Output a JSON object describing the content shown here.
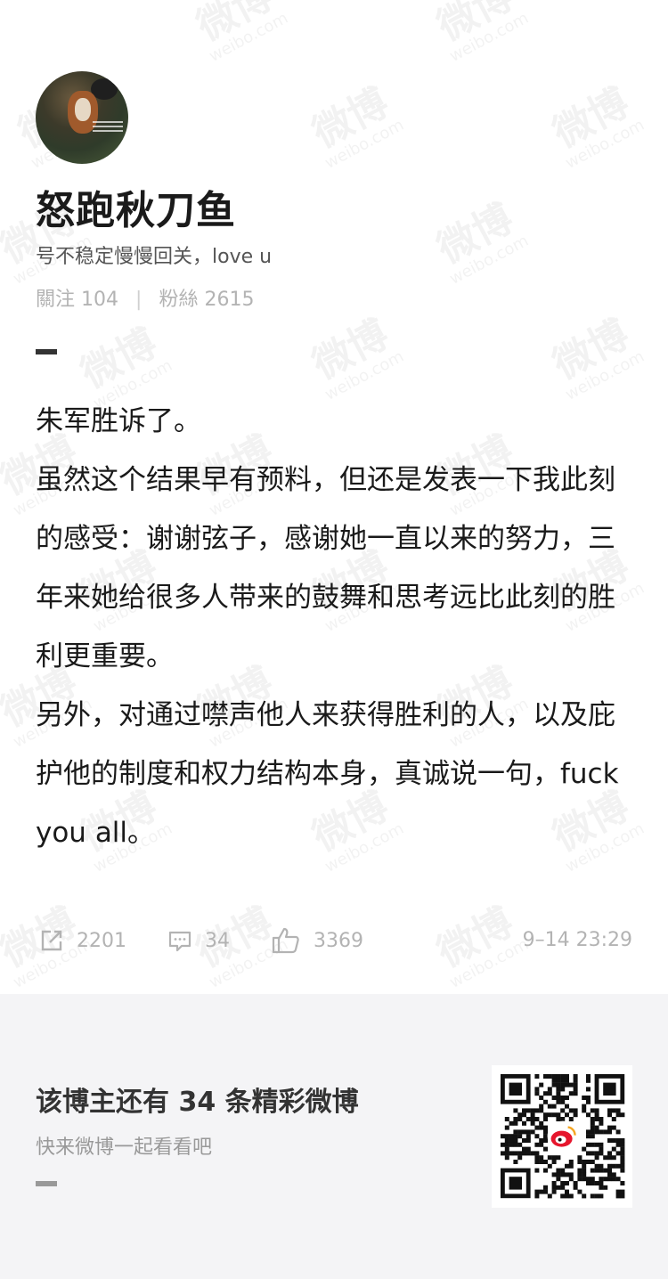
{
  "profile": {
    "username": "怒跑秋刀鱼",
    "bio": "号不稳定慢慢回关，love u",
    "following_label": "關注",
    "following_count": "104",
    "separator": "|",
    "followers_label": "粉絲",
    "followers_count": "2615"
  },
  "post": {
    "paragraphs": [
      "朱军胜诉了。",
      "虽然这个结果早有预料，但还是发表一下我此刻的感受：谢谢弦子，感谢她一直以来的努力，三年来她给很多人带来的鼓舞和思考远比此刻的胜利更重要。",
      "另外，对通过噤声他人来获得胜利的人，以及庇护他的制度和权力结构本身，真诚说一句，fuck you all。"
    ]
  },
  "actions": {
    "share_count": "2201",
    "comment_count": "34",
    "like_count": "3369",
    "timestamp": "9–14 23:29"
  },
  "footer": {
    "more_title": "该博主还有 34 条精彩微博",
    "more_subtitle": "快来微博一起看看吧"
  },
  "watermark": {
    "cn": "微博",
    "en": "weibo.com"
  },
  "icons": {
    "share": "share-icon",
    "comment": "comment-icon",
    "like": "thumbs-up-icon",
    "qr": "qr-code",
    "weibo": "weibo-logo-icon"
  },
  "colors": {
    "text": "#1a1a1a",
    "muted": "#b3b3b3",
    "footer_bg": "#f4f4f6",
    "weibo_red": "#e6162d"
  }
}
